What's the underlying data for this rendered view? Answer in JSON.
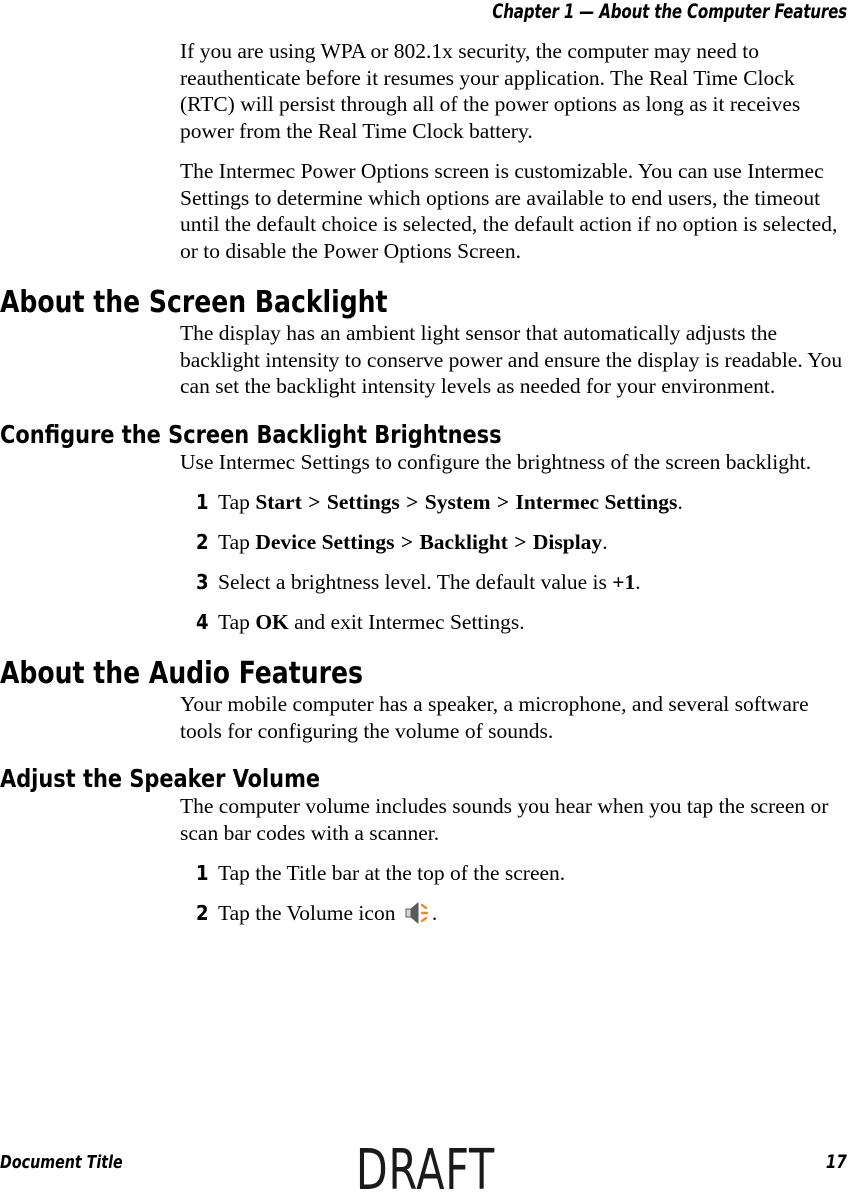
{
  "header": {
    "running_head": "Chapter 1 — About the Computer Features"
  },
  "body": {
    "paragraph_1": "If you are using WPA or 802.1x security, the computer may need to reauthenticate before it resumes your application. The Real Time Clock (RTC) will persist through all of the power options as long as it receives power from the Real Time Clock battery.",
    "paragraph_2": "The Intermec Power Options screen is customizable. You can use Intermec Settings to determine which options are available to end users, the timeout until the default choice is selected, the default action if no option is selected, or to disable the Power Options Screen.",
    "heading_backlight": "About the Screen Backlight",
    "paragraph_3": "The display has an ambient light sensor that automatically adjusts the backlight intensity to conserve power and ensure the display is readable. You can set the backlight intensity levels as needed for your environment.",
    "heading_configure_backlight": "Configure the Screen Backlight Brightness",
    "paragraph_4": "Use Intermec Settings to configure the brightness of the screen backlight.",
    "heading_audio": "About the Audio Features",
    "paragraph_5": "Your mobile computer has a speaker, a microphone, and several software tools for configuring the volume of sounds.",
    "heading_speaker_volume": "Adjust the Speaker Volume",
    "paragraph_6": "The computer volume includes sounds you hear when you tap the screen or scan bar codes with a scanner."
  },
  "backlight_steps": [
    {
      "number": "1",
      "prefix": "Tap ",
      "bold_parts": [
        "Start",
        "Settings",
        "System",
        "Intermec Settings"
      ],
      "separator": ">",
      "suffix": "."
    },
    {
      "number": "2",
      "prefix": "Tap ",
      "bold_parts": [
        "Device Settings",
        "Backlight",
        "Display"
      ],
      "separator": ">",
      "suffix": "."
    },
    {
      "number": "3",
      "prefix": "Select a brightness level. The default value is ",
      "bold_parts": [
        "+1"
      ],
      "separator": "",
      "suffix": "."
    },
    {
      "number": "4",
      "prefix": "Tap ",
      "bold_parts": [
        "OK"
      ],
      "separator": "",
      "suffix": " and exit Intermec Settings."
    }
  ],
  "volume_steps": [
    {
      "number": "1",
      "text": "Tap the Title bar at the top of the screen."
    },
    {
      "number": "2",
      "prefix": "Tap the Volume icon ",
      "icon": "volume-speaker-icon",
      "suffix": "."
    }
  ],
  "footer": {
    "left": "Document Title",
    "watermark": "DRAFT",
    "page_number": "17"
  },
  "colors": {
    "text": "#000000",
    "speaker_body": "#5a5a5a",
    "speaker_light": "#d8d8d8",
    "sound_waves": "#f08a1e"
  }
}
